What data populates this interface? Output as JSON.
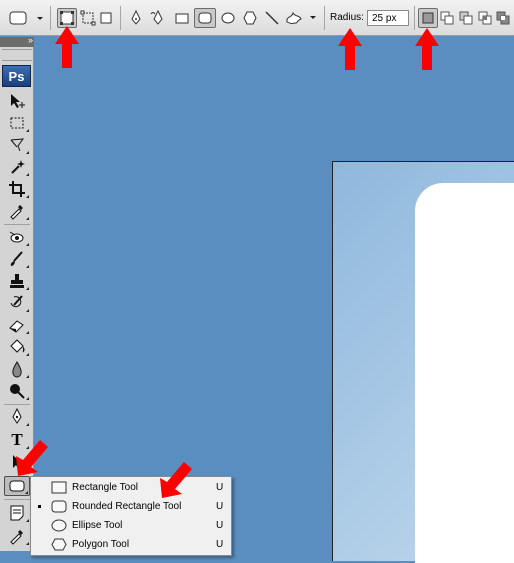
{
  "options_bar": {
    "radius_label": "Radius:",
    "radius_value": "25 px",
    "preset_icon": "rounded-rectangle-icon",
    "path_modes": [
      "shape-layers-icon",
      "paths-icon",
      "fill-pixels-icon"
    ],
    "shape_tools": [
      "pen-icon",
      "freeform-pen-icon",
      "rectangle-icon",
      "rounded-rectangle-icon",
      "ellipse-icon",
      "polygon-icon",
      "line-icon",
      "custom-shape-icon"
    ],
    "combine_modes": [
      "create-new-shape-layer-icon",
      "add-to-shape-area-icon",
      "subtract-icon",
      "intersect-icon",
      "exclude-icon"
    ]
  },
  "toolbox": {
    "logo": "Ps",
    "collapse_glyph": "»",
    "tools": [
      "move-tool-icon",
      "marquee-tool-icon",
      "lasso-tool-icon",
      "magic-wand-icon",
      "crop-tool-icon",
      "eyedropper-tool-icon",
      "healing-brush-icon",
      "brush-tool-icon",
      "clone-stamp-icon",
      "history-brush-icon",
      "eraser-tool-icon",
      "paint-bucket-icon",
      "blur-tool-icon",
      "dodge-tool-icon",
      "pen-tool-icon",
      "type-tool-icon",
      "path-selection-icon",
      "rounded-rectangle-tool-icon",
      "notes-tool-icon",
      "eyedropper-tool-icon"
    ],
    "type_tool_glyph": "T"
  },
  "flyout": {
    "items": [
      {
        "label": "Rectangle Tool",
        "shortcut": "U",
        "selected": false,
        "icon": "rectangle-icon"
      },
      {
        "label": "Rounded Rectangle Tool",
        "shortcut": "U",
        "selected": true,
        "icon": "rounded-rectangle-icon"
      },
      {
        "label": "Ellipse Tool",
        "shortcut": "U",
        "selected": false,
        "icon": "ellipse-icon"
      },
      {
        "label": "Polygon Tool",
        "shortcut": "U",
        "selected": false,
        "icon": "polygon-icon"
      }
    ]
  },
  "colors": {
    "workspace": "#5b8ec0",
    "annotation_arrow": "#ff0000",
    "canvas_shape": "#ffffff"
  }
}
